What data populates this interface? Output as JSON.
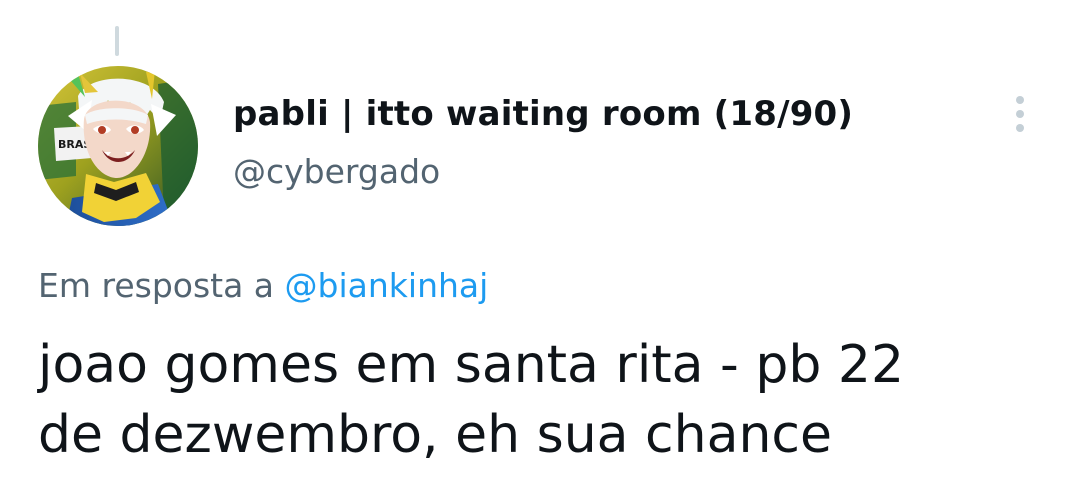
{
  "tweet": {
    "author": {
      "display_name": "pabli | itto waiting room (18/90)",
      "handle": "@cybergado",
      "avatar_label": "BRASIL"
    },
    "more_icon": "more-vertical-icon",
    "reply_prefix": "Em resposta a",
    "reply_mention": "@biankinhaj",
    "text_line1": "joao gomes em santa rita - pb 22",
    "text_line2": "de dezwembro, eh sua chance"
  },
  "colors": {
    "text_primary": "#0f1419",
    "text_secondary": "#536471",
    "mention": "#1d9bf0",
    "thread_line": "#cfd9de",
    "icon_dots": "#c4cfd6"
  }
}
